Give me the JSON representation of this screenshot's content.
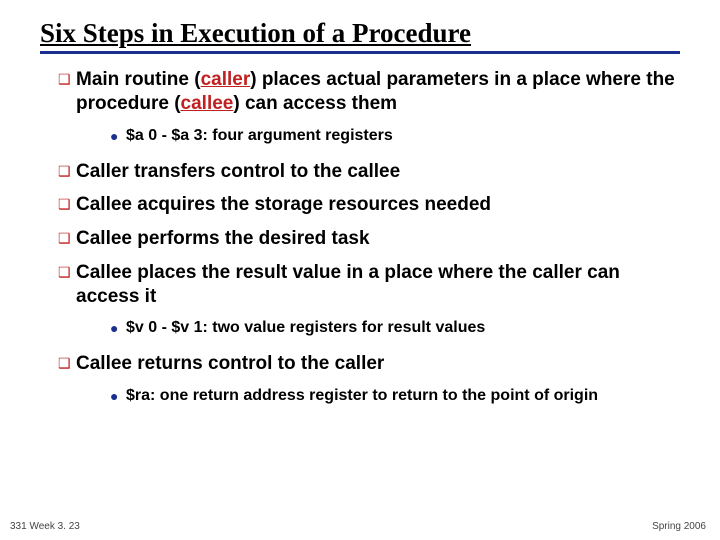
{
  "title": "Six Steps in Execution of a Procedure",
  "items": [
    {
      "pre": "Main routine (",
      "callout": "caller",
      "post": ") places actual parameters in a place where the procedure (",
      "callout2": "callee",
      "post2": ") can access them",
      "sub": "$a 0 - $a 3: four argument registers"
    },
    {
      "pre": "Caller transfers control to the callee"
    },
    {
      "pre": "Callee acquires the storage resources needed"
    },
    {
      "pre": "Callee performs the desired task"
    },
    {
      "pre": "Callee places the result value in a place where the caller can access it",
      "sub": "$v 0 - $v 1:  two value registers for result values"
    },
    {
      "pre": "Callee returns control to the caller",
      "sub": "$ra: one return address register to return to the point of origin"
    }
  ],
  "footer": {
    "left": "331 Week 3. 23",
    "right": "Spring 2006"
  },
  "markers": {
    "box": "❑",
    "dot": "●"
  }
}
